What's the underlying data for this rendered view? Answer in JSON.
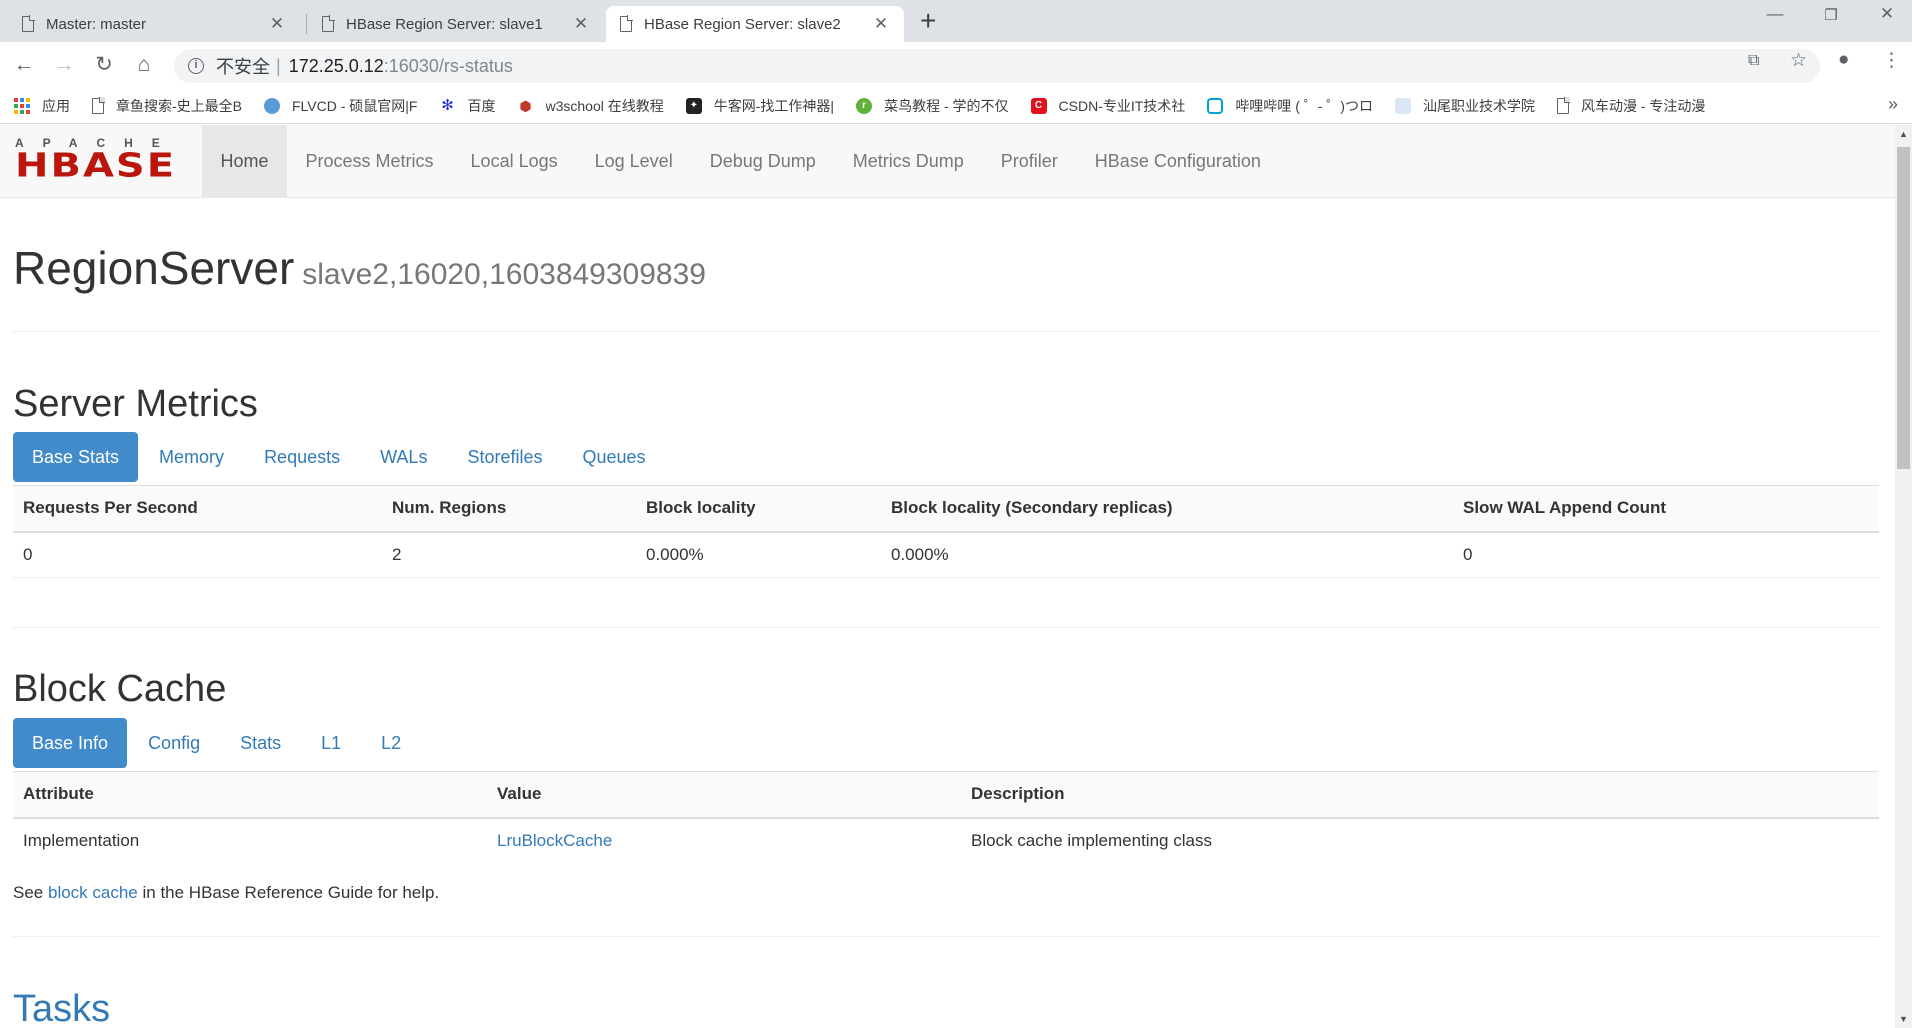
{
  "browser": {
    "tabs": [
      {
        "title": "Master: master"
      },
      {
        "title": "HBase Region Server: slave1"
      },
      {
        "title": "HBase Region Server: slave2"
      }
    ],
    "new_tab": "+",
    "address": {
      "insecure_label": "不安全",
      "separator": "|",
      "host": "172.25.0.12",
      "path": ":16030/rs-status"
    },
    "bookmarks": [
      {
        "label": "应用",
        "icon": "apps-grid-icon",
        "color": "#4285f4"
      },
      {
        "label": "章鱼搜索-史上最全B",
        "icon": "page-icon",
        "color": "#5f6368"
      },
      {
        "label": "FLVCD - 硕鼠官网|F",
        "icon": "globe-icon",
        "color": "#5b9bd5"
      },
      {
        "label": "百度",
        "icon": "paw-icon",
        "color": "#2932e1"
      },
      {
        "label": "w3school 在线教程",
        "icon": "w3-icon",
        "color": "#c0392b"
      },
      {
        "label": "牛客网-找工作神器|",
        "icon": "nowcoder-icon",
        "color": "#222222"
      },
      {
        "label": "菜鸟教程 - 学的不仅",
        "icon": "runoob-icon",
        "color": "#5fb336"
      },
      {
        "label": "CSDN-专业IT技术社",
        "icon": "csdn-icon",
        "color": "#e3101e"
      },
      {
        "label": "哔哩哔哩 ( ゜- ゜)つロ",
        "icon": "bilibili-icon",
        "color": "#00a1d6"
      },
      {
        "label": "汕尾职业技术学院",
        "icon": "blank-icon",
        "color": "#dce7f5"
      },
      {
        "label": "风车动漫 - 专注动漫",
        "icon": "page-icon",
        "color": "#5f6368"
      }
    ],
    "more": "»"
  },
  "navbar": {
    "logo_top": "APACHE",
    "logo_main": "HBASE",
    "items": [
      {
        "label": "Home"
      },
      {
        "label": "Process Metrics"
      },
      {
        "label": "Local Logs"
      },
      {
        "label": "Log Level"
      },
      {
        "label": "Debug Dump"
      },
      {
        "label": "Metrics Dump"
      },
      {
        "label": "Profiler"
      },
      {
        "label": "HBase Configuration"
      }
    ]
  },
  "page": {
    "title": "RegionServer",
    "subtitle": "slave2,16020,1603849309839"
  },
  "server_metrics": {
    "heading": "Server Metrics",
    "tabs": [
      "Base Stats",
      "Memory",
      "Requests",
      "WALs",
      "Storefiles",
      "Queues"
    ],
    "columns": [
      "Requests Per Second",
      "Num. Regions",
      "Block locality",
      "Block locality (Secondary replicas)",
      "Slow WAL Append Count"
    ],
    "row": [
      "0",
      "2",
      "0.000%",
      "0.000%",
      "0"
    ]
  },
  "block_cache": {
    "heading": "Block Cache",
    "tabs": [
      "Base Info",
      "Config",
      "Stats",
      "L1",
      "L2"
    ],
    "columns": [
      "Attribute",
      "Value",
      "Description"
    ],
    "row": {
      "attribute": "Implementation",
      "value": "LruBlockCache",
      "description": "Block cache implementing class"
    },
    "help_prefix": "See ",
    "help_link": "block cache",
    "help_suffix": " in the HBase Reference Guide for help."
  },
  "tasks": {
    "heading": "Tasks"
  }
}
